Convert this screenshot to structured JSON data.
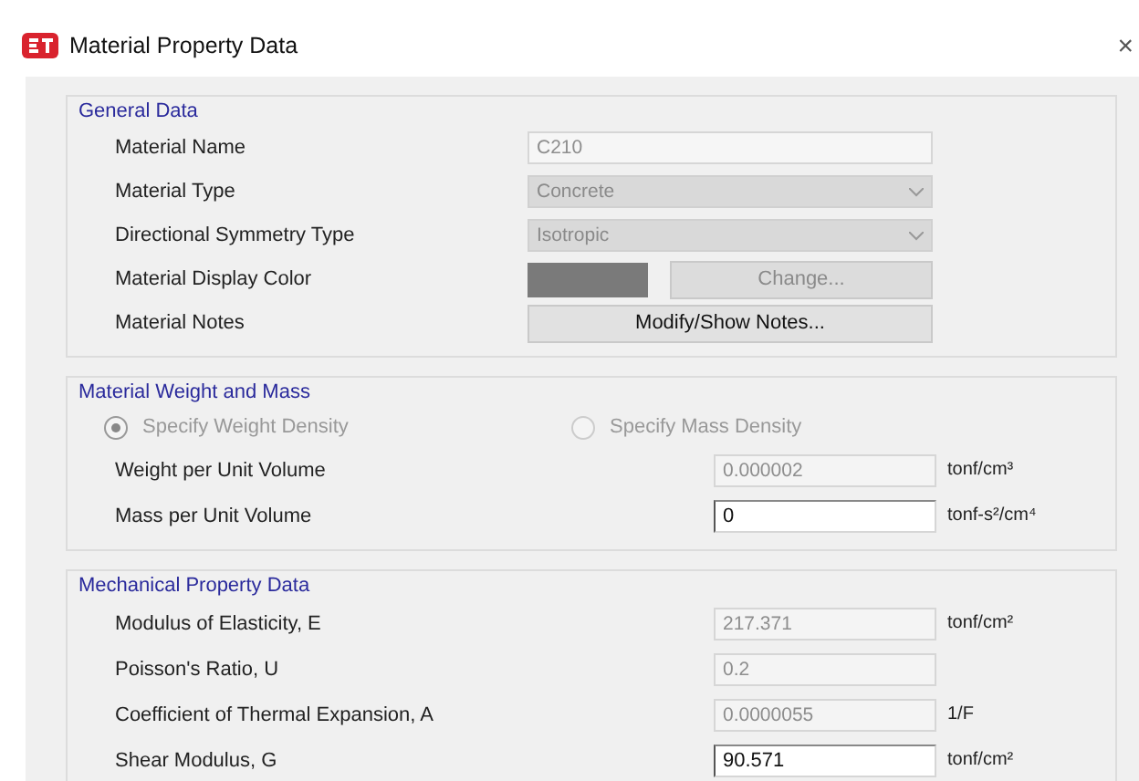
{
  "window": {
    "title": "Material Property Data",
    "close": "×"
  },
  "general": {
    "title": "General Data",
    "rows": [
      {
        "kind": "text",
        "label": "Material Name",
        "value": "C210",
        "disabled": true
      },
      {
        "kind": "combo",
        "label": "Material Type",
        "value": "Concrete",
        "disabled": true
      },
      {
        "kind": "combo",
        "label": "Directional Symmetry Type",
        "value": "Isotropic",
        "disabled": true
      },
      {
        "kind": "color",
        "label": "Material Display Color",
        "color": "#7a7a7a",
        "button": "Change...",
        "disabled": true
      },
      {
        "kind": "button",
        "label": "Material Notes",
        "button": "Modify/Show Notes...",
        "disabled": false
      }
    ]
  },
  "weight": {
    "title": "Material Weight and Mass",
    "radios": [
      {
        "label": "Specify Weight Density",
        "selected": true,
        "disabled": true
      },
      {
        "label": "Specify Mass Density",
        "selected": false,
        "disabled": true
      }
    ],
    "rows": [
      {
        "label": "Weight per Unit Volume",
        "value": "0.000002",
        "unit": "tonf/cm³",
        "disabled": true
      },
      {
        "label": "Mass per Unit Volume",
        "value": "0",
        "unit": "tonf-s²/cm⁴",
        "disabled": false
      }
    ]
  },
  "mechanical": {
    "title": "Mechanical Property Data",
    "rows": [
      {
        "label": "Modulus of Elasticity,  E",
        "value": "217.371",
        "unit": "tonf/cm²",
        "disabled": true
      },
      {
        "label": "Poisson's Ratio,  U",
        "value": "0.2",
        "disabled": true
      },
      {
        "label": "Coefficient of Thermal Expansion,  A",
        "value": "0.0000055",
        "unit": "1/F",
        "disabled": true
      },
      {
        "label": "Shear Modulus,  G",
        "value": "90.571",
        "unit": "tonf/cm²",
        "disabled": false
      }
    ]
  }
}
